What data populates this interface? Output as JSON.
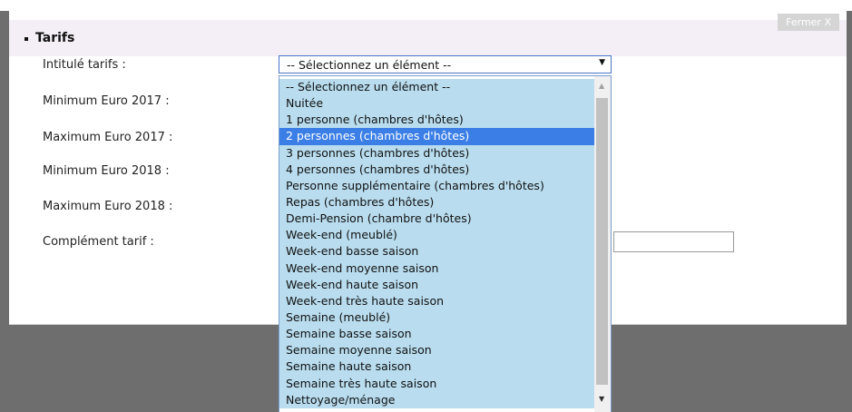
{
  "panel": {
    "title": "Tarifs",
    "close_label": "Fermer X"
  },
  "form": {
    "labels": {
      "intitule": "Intitulé tarifs :",
      "min_2017": "Minimum Euro 2017 :",
      "max_2017": "Maximum Euro 2017 :",
      "min_2018": "Minimum Euro 2018 :",
      "max_2018": "Maximum Euro 2018 :",
      "complement": "Complément tarif :"
    },
    "select_value": "-- Sélectionnez un élément --",
    "select_arrow": "▼",
    "complement_value": ""
  },
  "dropdown": {
    "selected_index": 3,
    "options": [
      "-- Sélectionnez un élément --",
      "Nuitée",
      "1 personne (chambres d'hôtes)",
      "2 personnes (chambres d'hôtes)",
      "3 personnes (chambres d'hôtes)",
      "4 personnes (chambres d'hôtes)",
      "Personne supplémentaire (chambres d'hôtes)",
      "Repas (chambres d'hôtes)",
      "Demi-Pension (chambre d'hôtes)",
      "Week-end (meublé)",
      "Week-end basse saison",
      "Week-end moyenne saison",
      "Week-end haute saison",
      "Week-end très haute saison",
      "Semaine (meublé)",
      "Semaine basse saison",
      "Semaine moyenne saison",
      "Semaine haute saison",
      "Semaine très haute saison",
      "Nettoyage/ménage"
    ],
    "scroll_up": "▲",
    "scroll_down": "▼"
  }
}
